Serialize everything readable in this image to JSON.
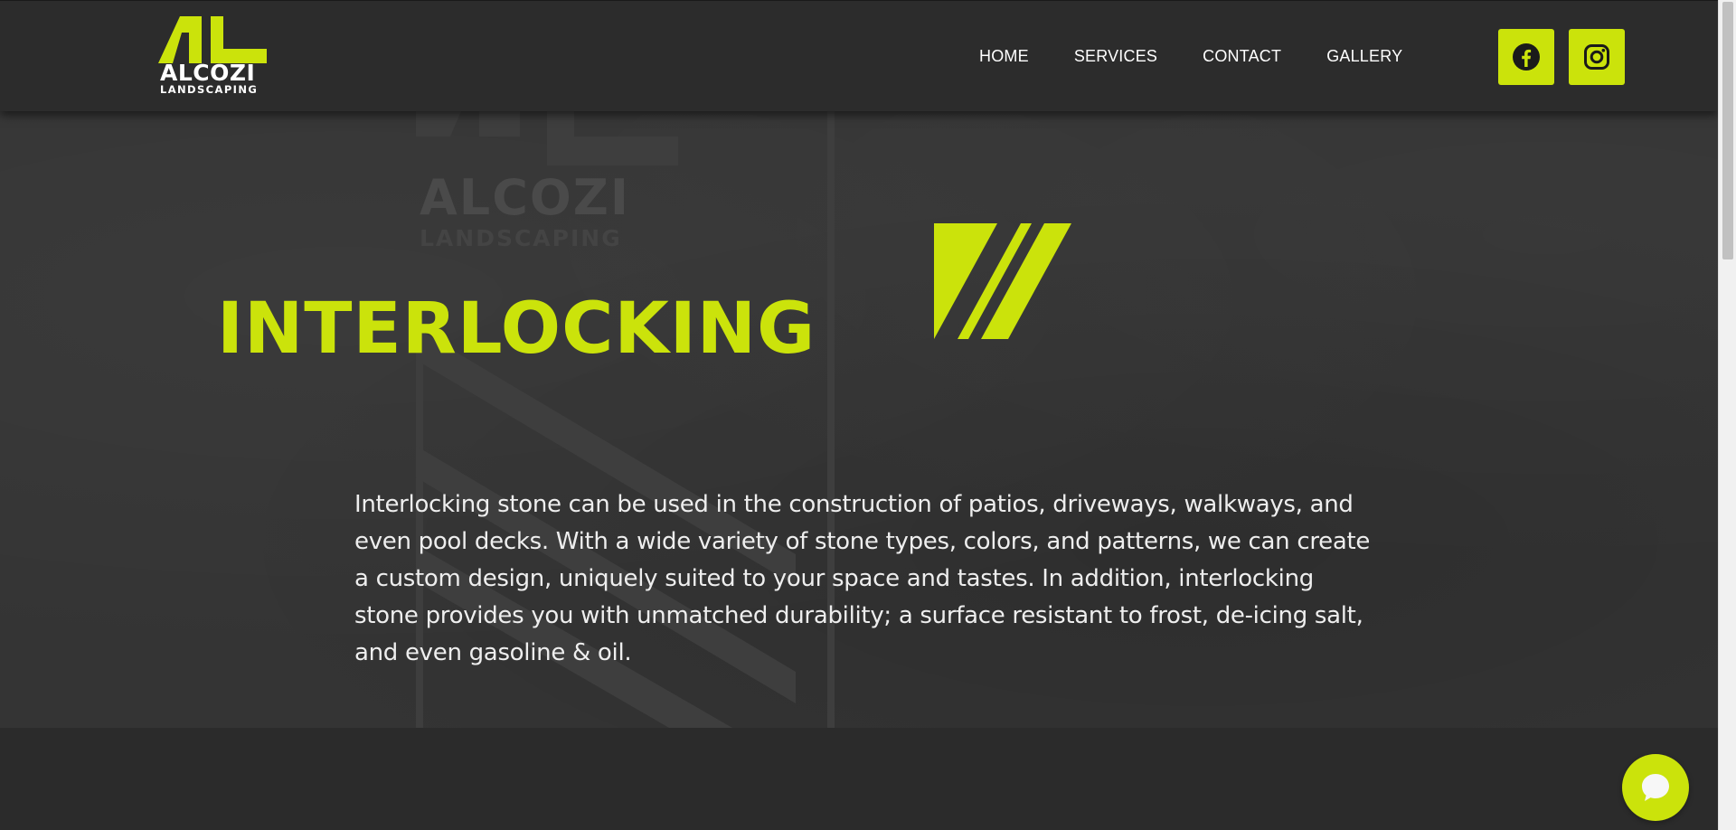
{
  "header": {
    "logo": {
      "word": "ALCOZI",
      "sub": "LANDSCAPING"
    },
    "nav": [
      {
        "label": "HOME"
      },
      {
        "label": "SERVICES"
      },
      {
        "label": "CONTACT"
      },
      {
        "label": "GALLERY"
      }
    ],
    "social": [
      {
        "icon": "facebook-icon"
      },
      {
        "icon": "instagram-icon"
      }
    ]
  },
  "hero": {
    "title": "INTERLOCKING",
    "description": "Interlocking stone can be used in the construction of patios, driveways, walkways, and even pool decks.  With a wide variety of stone types, colors, and patterns, we can create a custom design, uniquely suited to your space and tastes. In addition, interlocking stone provides you with unmatched durability; a surface resistant to frost, de-icing salt, and even gasoline & oil."
  },
  "chat": {
    "icon": "chat-bubble-icon"
  },
  "colors": {
    "accent": "#cbe30b",
    "header_bg": "#2c2c2c",
    "hero_bg": "#343434",
    "text": "#ffffff"
  }
}
